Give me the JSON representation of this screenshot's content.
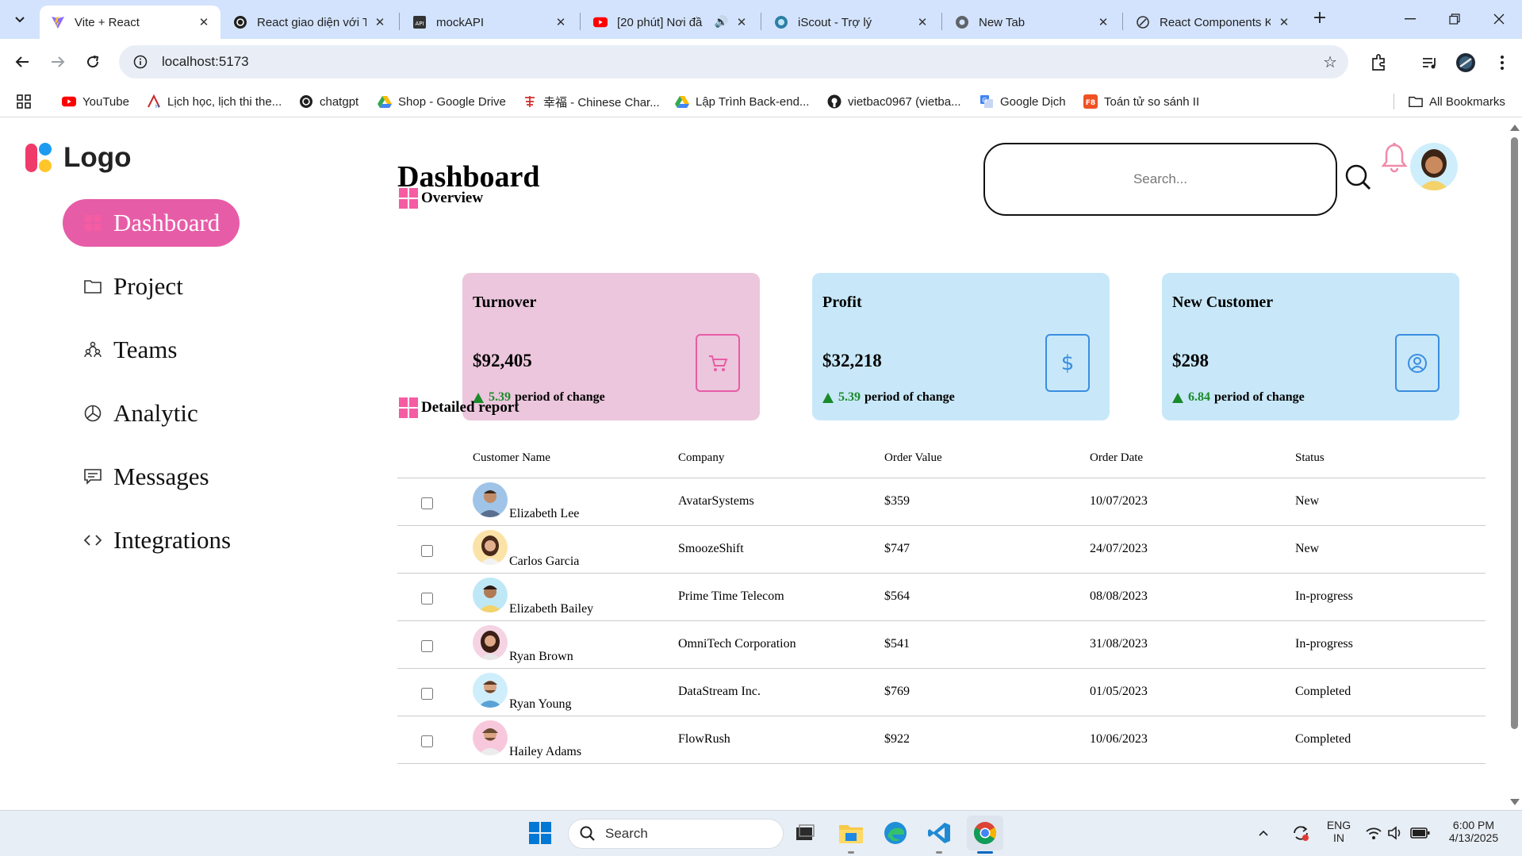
{
  "browser": {
    "tabs": [
      {
        "title": "Vite + React",
        "active": true,
        "icon": "vite-icon"
      },
      {
        "title": "React giao diện với T",
        "active": false,
        "icon": "chatgpt-icon"
      },
      {
        "title": "mockAPI",
        "active": false,
        "icon": "mockapi-icon"
      },
      {
        "title": "[20 phút] Nơi đầ",
        "active": false,
        "icon": "youtube-icon"
      },
      {
        "title": "iScout - Trợ lý",
        "active": false,
        "icon": "iscout-icon"
      },
      {
        "title": "New Tab",
        "active": false,
        "icon": "chrome-icon"
      },
      {
        "title": "React Components K",
        "active": false,
        "icon": "react-icon"
      }
    ],
    "url": "localhost:5173",
    "bookmarks": [
      {
        "label": "YouTube",
        "icon": "youtube-icon"
      },
      {
        "label": "Lịch học, lịch thi the...",
        "icon": "school-icon"
      },
      {
        "label": "chatgpt",
        "icon": "chatgpt-icon"
      },
      {
        "label": "Shop - Google Drive",
        "icon": "drive-icon"
      },
      {
        "label": "幸福 - Chinese Char...",
        "icon": "chinese-char-icon"
      },
      {
        "label": "Lập Trình Back-end...",
        "icon": "drive-icon"
      },
      {
        "label": "vietbac0967 (vietba...",
        "icon": "github-icon"
      },
      {
        "label": "Google Dịch",
        "icon": "translate-icon"
      },
      {
        "label": "Toán tử so sánh II",
        "icon": "f8-icon"
      }
    ],
    "all_bookmarks": "All Bookmarks"
  },
  "sidebar": {
    "logo": "Logo",
    "items": [
      {
        "label": "Dashboard",
        "icon": "dashboard-icon",
        "active": true
      },
      {
        "label": "Project",
        "icon": "folder-icon",
        "active": false
      },
      {
        "label": "Teams",
        "icon": "teams-icon",
        "active": false
      },
      {
        "label": "Analytic",
        "icon": "pie-chart-icon",
        "active": false
      },
      {
        "label": "Messages",
        "icon": "message-icon",
        "active": false
      },
      {
        "label": "Integrations",
        "icon": "code-icon",
        "active": false
      }
    ]
  },
  "header": {
    "title": "Dashboard",
    "search_placeholder": "Search..."
  },
  "overview": {
    "heading": "Overview",
    "cards": [
      {
        "title": "Turnover",
        "value": "$92,405",
        "change": "5.39",
        "change_label": "period of change",
        "icon": "cart-icon",
        "color": "#ecc6dc"
      },
      {
        "title": "Profit",
        "value": "$32,218",
        "change": "5.39",
        "change_label": "period of change",
        "icon": "dollar-icon",
        "color": "#c8e8f9"
      },
      {
        "title": "New Customer",
        "value": "$298",
        "change": "6.84",
        "change_label": "period of change",
        "icon": "user-icon",
        "color": "#c8e8f9"
      }
    ]
  },
  "report": {
    "heading": "Detailed report",
    "columns": [
      "Customer Name",
      "Company",
      "Order Value",
      "Order Date",
      "Status"
    ],
    "rows": [
      {
        "name": "Elizabeth Lee",
        "company": "AvatarSystems",
        "value": "$359",
        "date": "10/07/2023",
        "status": "New"
      },
      {
        "name": "Carlos Garcia",
        "company": "SmoozeShift",
        "value": "$747",
        "date": "24/07/2023",
        "status": "New"
      },
      {
        "name": "Elizabeth Bailey",
        "company": "Prime Time Telecom",
        "value": "$564",
        "date": "08/08/2023",
        "status": "In-progress"
      },
      {
        "name": "Ryan Brown",
        "company": "OmniTech Corporation",
        "value": "$541",
        "date": "31/08/2023",
        "status": "In-progress"
      },
      {
        "name": "Ryan Young",
        "company": "DataStream Inc.",
        "value": "$769",
        "date": "01/05/2023",
        "status": "Completed"
      },
      {
        "name": "Hailey Adams",
        "company": "FlowRush",
        "value": "$922",
        "date": "10/06/2023",
        "status": "Completed"
      }
    ]
  },
  "taskbar": {
    "search": "Search",
    "lang": "ENG",
    "region": "IN",
    "time": "6:00 PM",
    "date": "4/13/2025"
  },
  "colors": {
    "accent_pink": "#e75ca7",
    "card_pink": "#ecc6dc",
    "card_blue": "#c8e8f9",
    "positive_green": "#1a8a2a"
  }
}
